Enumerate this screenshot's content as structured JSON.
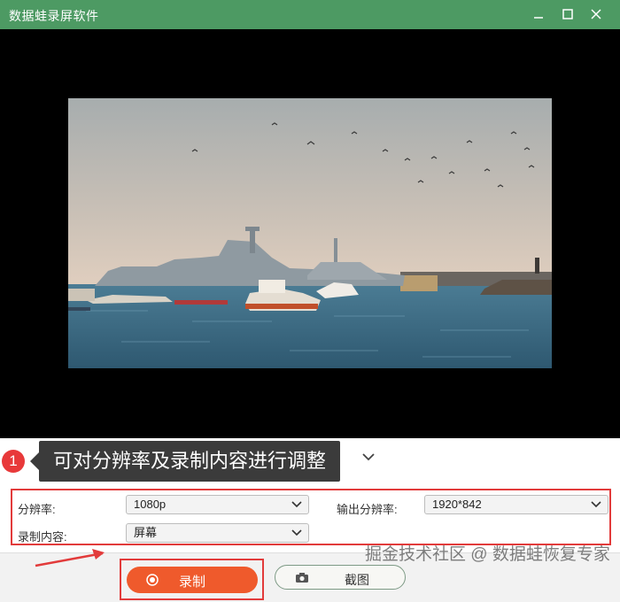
{
  "app": {
    "title": "数据蛙录屏软件"
  },
  "annotation": {
    "step": "1",
    "text": "可对分辨率及录制内容进行调整"
  },
  "settings": {
    "resolution": {
      "label": "分辨率:",
      "value": "1080p"
    },
    "output_resolution": {
      "label": "输出分辨率:",
      "value": "1920*842"
    },
    "content": {
      "label": "录制内容:",
      "value": "屏幕"
    }
  },
  "actions": {
    "record_label": "录制",
    "screenshot_label": "截图"
  },
  "watermark": "掘金技术社区 @ 数据蛙恢复专家",
  "colors": {
    "titlebar": "#4d9a63",
    "record": "#ef5a2c",
    "highlight": "#e23b3b"
  }
}
